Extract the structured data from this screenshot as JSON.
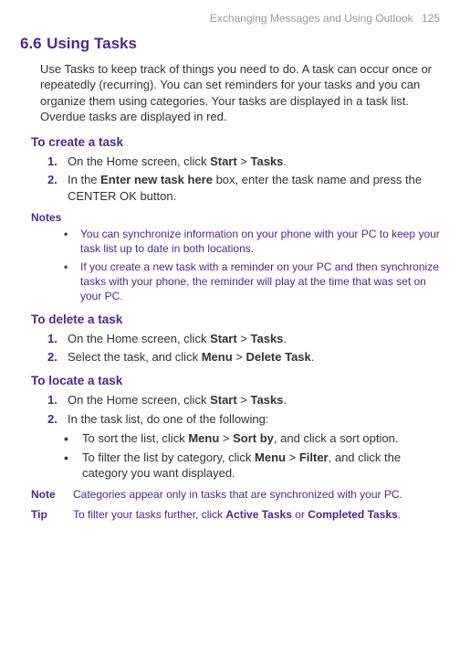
{
  "header": {
    "chapter": "Exchanging Messages and Using Outlook",
    "page": "125"
  },
  "section": {
    "num": "6.6",
    "title": "Using Tasks"
  },
  "intro": "Use Tasks to keep track of things you need to do. A task can occur once or repeatedly (recurring). You can set reminders for your tasks and you can organize them using categories. Your tasks are displayed in a task list. Overdue tasks are displayed in red.",
  "create": {
    "heading": "To create a task",
    "step1_pre": "On the Home screen, click ",
    "step1_b1": "Start",
    "step1_mid": " > ",
    "step1_b2": "Tasks",
    "step1_post": ".",
    "step2_pre": "In the ",
    "step2_b1": "Enter new task here",
    "step2_post": " box, enter the task name and press the CENTER OK button."
  },
  "notesLabel": "Notes",
  "notes": {
    "n1": "You can synchronize information on your phone with your PC to keep your task list up to date in both locations.",
    "n2": "If you create a new task with a reminder on your PC and then synchronize tasks with your phone, the reminder will play at the time that was set on your PC."
  },
  "delete": {
    "heading": "To delete a task",
    "step1_pre": "On the Home screen, click ",
    "step1_b1": "Start",
    "step1_mid": " > ",
    "step1_b2": "Tasks",
    "step1_post": ".",
    "step2_pre": "Select the task, and click ",
    "step2_b1": "Menu",
    "step2_mid": " > ",
    "step2_b2": "Delete Task",
    "step2_post": "."
  },
  "locate": {
    "heading": "To locate a task",
    "step1_pre": "On the Home screen, click ",
    "step1_b1": "Start",
    "step1_mid": " > ",
    "step1_b2": "Tasks",
    "step1_post": ".",
    "step2": "In the task list, do one of the following:",
    "b1_pre": "To sort the list, click ",
    "b1_b1": "Menu",
    "b1_mid": " > ",
    "b1_b2": "Sort by",
    "b1_post": ", and click a sort option.",
    "b2_pre": "To filter the list by category, click ",
    "b2_b1": "Menu",
    "b2_mid": " > ",
    "b2_b2": "Filter",
    "b2_post": ", and click the category you want displayed."
  },
  "noteRow": {
    "label": "Note",
    "text": "Categories appear only in tasks that are synchronized with your PC."
  },
  "tipRow": {
    "label": "Tip",
    "pre": "To filter your tasks further, click ",
    "b1": "Active Tasks",
    "mid": " or ",
    "b2": "Completed Tasks",
    "post": "."
  }
}
